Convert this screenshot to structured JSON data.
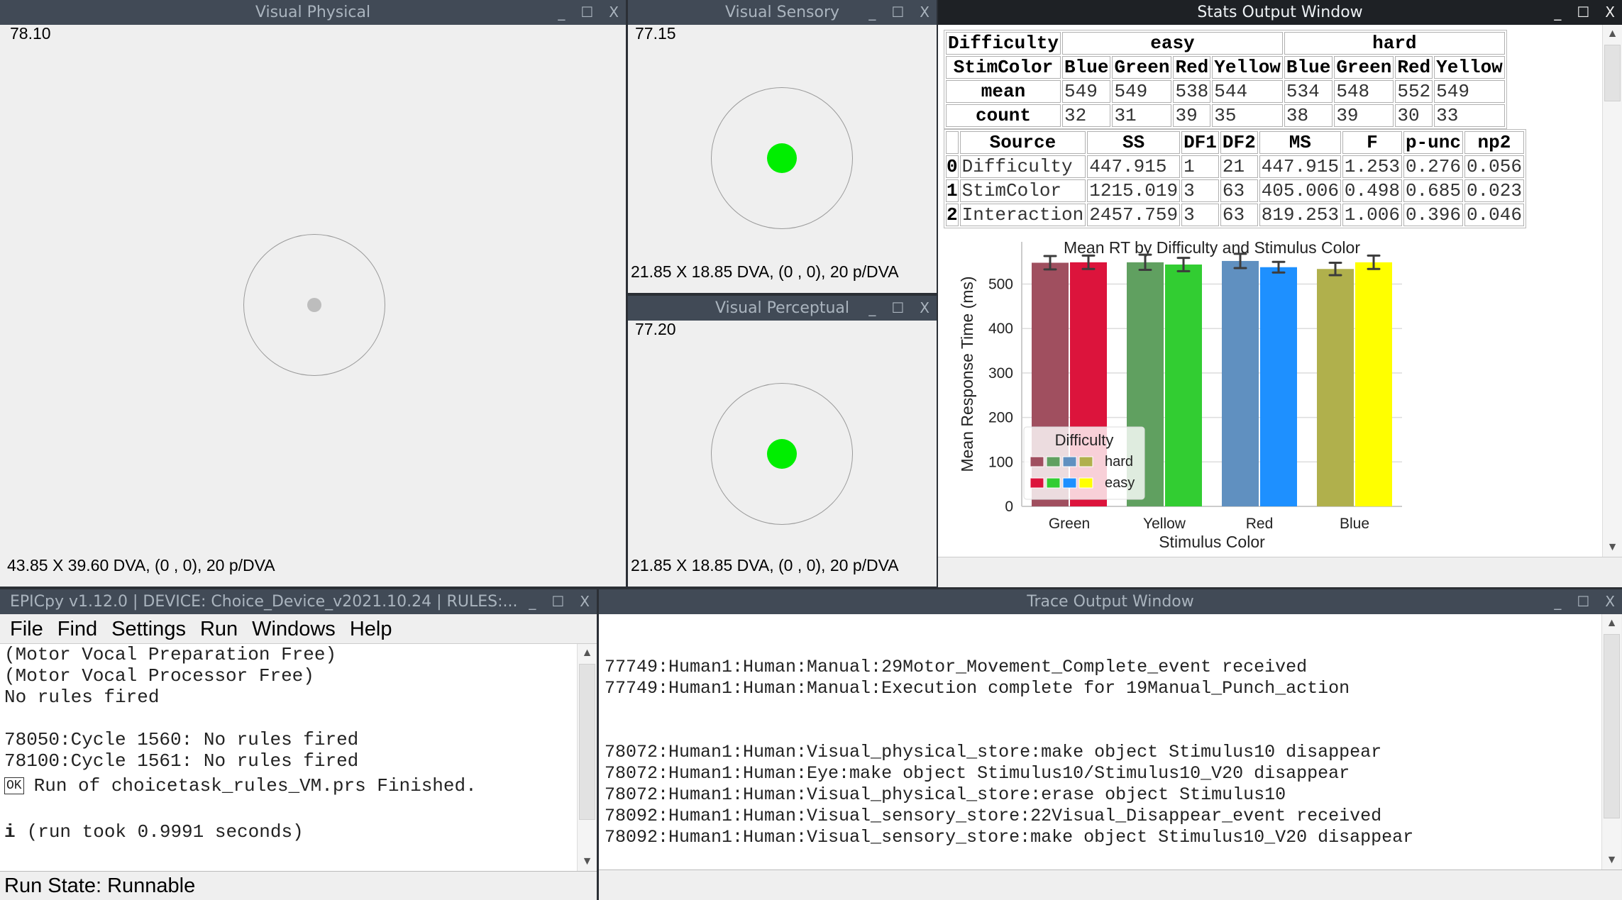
{
  "visual_physical": {
    "title": "Visual Physical",
    "time": "78.10",
    "footer": "43.85 X 39.60 DVA, (0 , 0), 20 p/DVA",
    "object_color": "#bdbdbd"
  },
  "visual_sensory": {
    "title": "Visual Sensory",
    "time": "77.15",
    "footer": "21.85 X 18.85 DVA, (0 , 0), 20 p/DVA",
    "object_color": "#00ee00"
  },
  "visual_perceptual": {
    "title": "Visual Perceptual",
    "time": "77.20",
    "footer": "21.85 X 18.85 DVA, (0 , 0), 20 p/DVA",
    "object_color": "#00ee00"
  },
  "window_buttons": {
    "minimize": "_",
    "maximize": "☐",
    "close": "X"
  },
  "stats": {
    "title": "Stats Output Window",
    "means_table": {
      "header1": [
        "Difficulty",
        "easy",
        "hard"
      ],
      "header2": [
        "StimColor",
        "Blue",
        "Green",
        "Red",
        "Yellow",
        "Blue",
        "Green",
        "Red",
        "Yellow"
      ],
      "rows": [
        [
          "mean",
          "549",
          "549",
          "538",
          "544",
          "534",
          "548",
          "552",
          "549"
        ],
        [
          "count",
          "32",
          "31",
          "39",
          "35",
          "38",
          "39",
          "30",
          "33"
        ]
      ]
    },
    "anova_table": {
      "headers": [
        "",
        "Source",
        "SS",
        "DF1",
        "DF2",
        "MS",
        "F",
        "p-unc",
        "np2"
      ],
      "rows": [
        [
          "0",
          "Difficulty",
          "447.915",
          "1",
          "21",
          "447.915",
          "1.253",
          "0.276",
          "0.056"
        ],
        [
          "1",
          "StimColor",
          "1215.019",
          "3",
          "63",
          "405.006",
          "0.498",
          "0.685",
          "0.023"
        ],
        [
          "2",
          "Interaction",
          "2457.759",
          "3",
          "63",
          "819.253",
          "1.006",
          "0.396",
          "0.046"
        ]
      ]
    }
  },
  "chart_data": {
    "type": "bar",
    "title": "Mean RT by Difficulty and Stimulus Color",
    "xlabel": "Stimulus Color",
    "ylabel": "Mean Response Time (ms)",
    "categories": [
      "Green",
      "Yellow",
      "Red",
      "Blue"
    ],
    "ylim": [
      0,
      595
    ],
    "yticks": [
      "0",
      "100",
      "200",
      "300",
      "400",
      "500"
    ],
    "grid": true,
    "legend": {
      "title": "Difficulty",
      "placement": "lower-left"
    },
    "series": [
      {
        "name": "hard",
        "values": [
          548,
          549,
          552,
          534
        ],
        "errors": [
          15,
          17,
          16,
          14
        ],
        "colors": [
          "#a04f5f",
          "#60a060",
          "#6090c0",
          "#b0b04c"
        ]
      },
      {
        "name": "easy",
        "values": [
          549,
          544,
          538,
          549
        ],
        "errors": [
          15,
          15,
          12,
          15
        ],
        "colors": [
          "#dc143c",
          "#32cd32",
          "#1e90ff",
          "#ffff00"
        ]
      }
    ]
  },
  "main": {
    "title": "EPICpy v1.12.0 | DEVICE: Choice_Device_v2021.10.24 | RULES:...",
    "menu": [
      "File",
      "Find",
      "Settings",
      "Run",
      "Windows",
      "Help"
    ],
    "lines": [
      "(Motor Vocal Preparation Free)",
      "(Motor Vocal Processor Free)",
      "No rules fired",
      "",
      "78050:Cycle 1560: No rules fired",
      "78100:Cycle 1561: No rules fired"
    ],
    "ok_badge": "OK",
    "finished": "Run of choicetask_rules_VM.prs Finished.",
    "info_badge": "i",
    "run_time": "(run took 0.9991 seconds)",
    "status": "Run State: Runnable"
  },
  "trace": {
    "title": "Trace Output Window",
    "lines": [
      "",
      "",
      "77749:Human1:Human:Manual:29Motor_Movement_Complete_event received",
      "77749:Human1:Human:Manual:Execution complete for 19Manual_Punch_action",
      "",
      "",
      "78072:Human1:Human:Visual_physical_store:make object Stimulus10 disappear",
      "78072:Human1:Human:Eye:make object Stimulus10/Stimulus10_V20 disappear",
      "78072:Human1:Human:Visual_physical_store:erase object Stimulus10",
      "78092:Human1:Human:Visual_sensory_store:22Visual_Disappear_event received",
      "78092:Human1:Human:Visual_sensory_store:make object Stimulus10_V20 disappear"
    ]
  }
}
